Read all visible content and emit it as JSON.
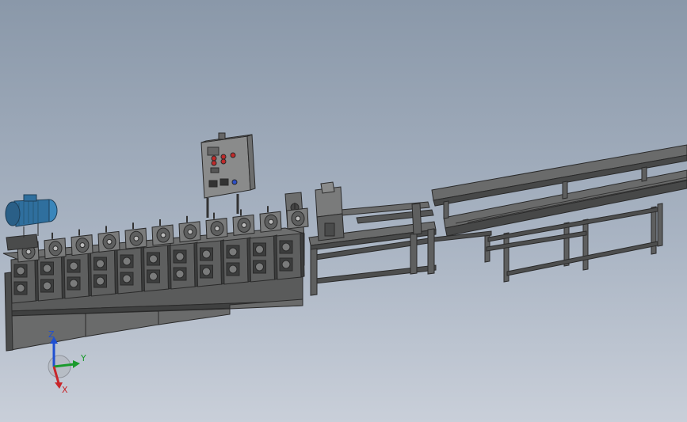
{
  "viewport": {
    "background_top": "#8a98a9",
    "background_bottom": "#c9cfd9"
  },
  "model": {
    "machine_color": "#5e5f5f",
    "machine_dark": "#3c3d3d",
    "machine_light": "#7a7b7b",
    "motor_color": "#2f6f9e",
    "control_box_color": "#8a8b8b",
    "control_buttons": [
      "red-button",
      "red-button",
      "red-button",
      "red-button",
      "red-button",
      "blue-button"
    ]
  },
  "triad": {
    "z_label": "Z",
    "y_label": "Y",
    "x_label": "X",
    "z_color": "#1f4fd1",
    "y_color": "#1a9a2c",
    "x_color": "#c8262a"
  }
}
